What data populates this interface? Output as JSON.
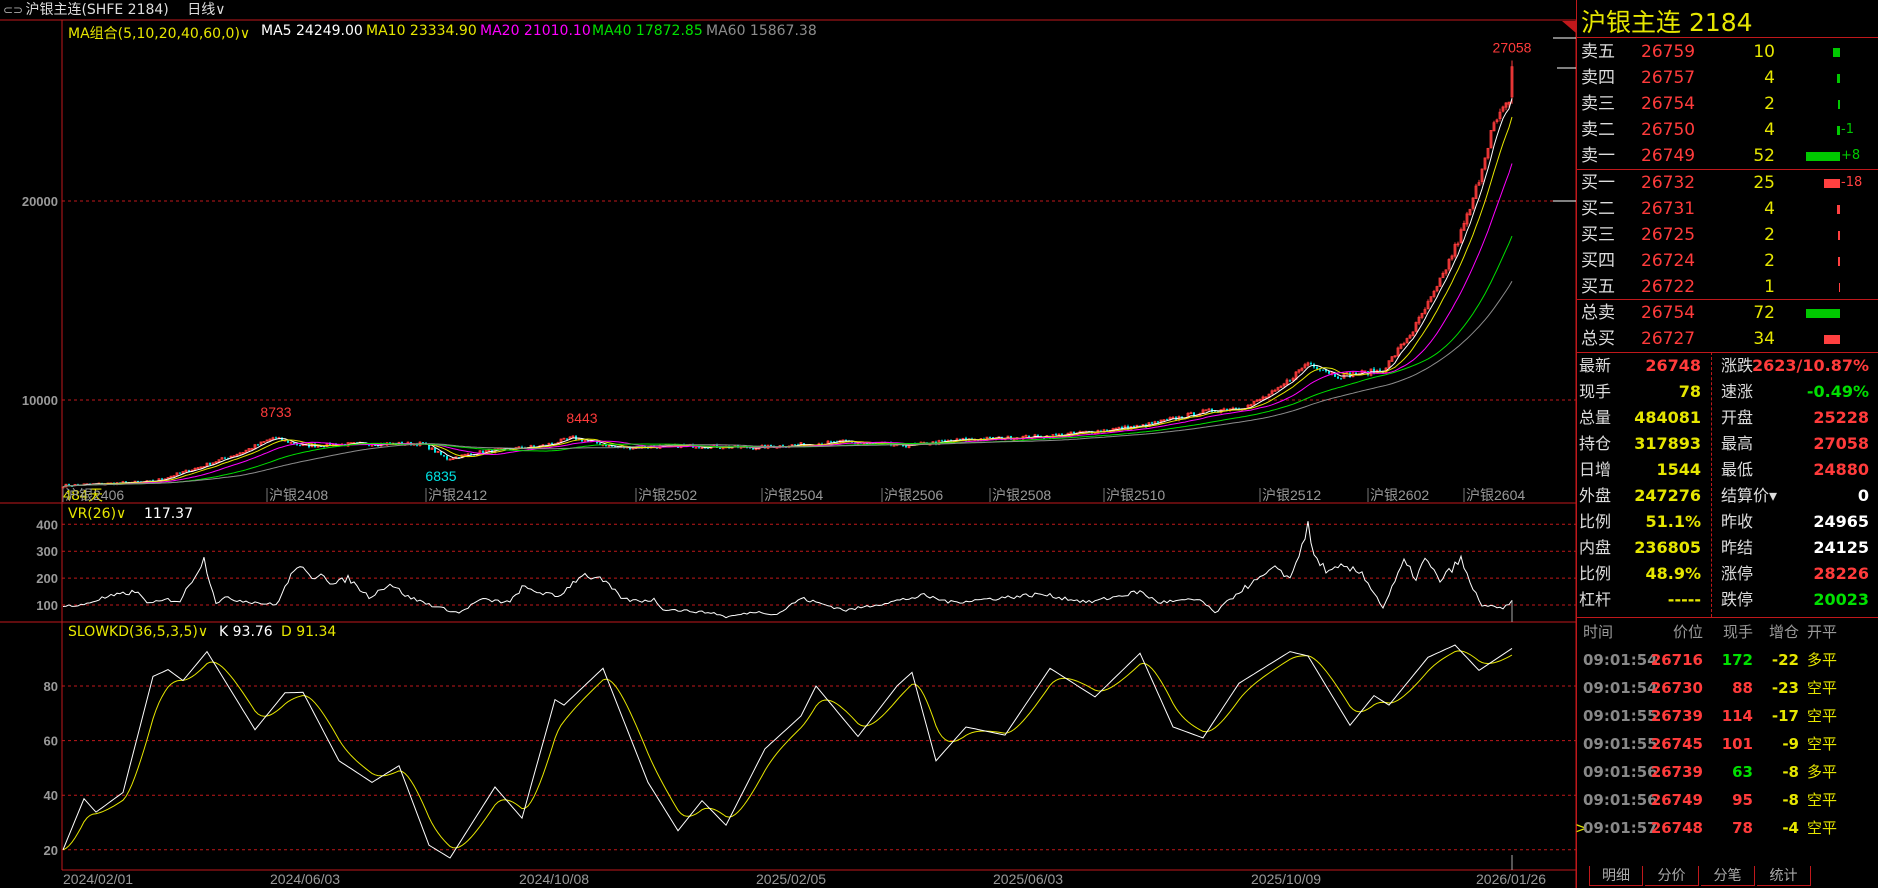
{
  "topbar": {
    "title": "沪银主连(SHFE 2184)",
    "period": "日线∨"
  },
  "indicators": {
    "ma_label": "MA组合(5,10,20,40,60,0)∨",
    "ma5": "MA5 24249.00",
    "ma10": "MA10 23334.90",
    "ma20": "MA20 21010.10",
    "ma40": "MA40 17872.85",
    "ma60": "MA60 15867.38",
    "vr_label": "VR(26)∨",
    "vr_value": "117.37",
    "kd_label": "SLOWKD(36,5,3,5)∨",
    "k_value": "K 93.76",
    "d_value": "D 91.34"
  },
  "colors": {
    "up": "#ff3b3b",
    "down": "#00e5e5",
    "ma5": "#ffffff",
    "ma10": "#e6e600",
    "ma20": "#ff00ff",
    "ma40": "#00e000",
    "ma60": "#8c8c8c",
    "grid": "#c0181b"
  },
  "chart_data": {
    "type": "candlestick",
    "bars": 484,
    "bar_count_label": "484天",
    "price_axis": {
      "ticks": [
        "20000",
        "10000"
      ],
      "values": [
        20000,
        10000
      ]
    },
    "close_anchors": [
      [
        0,
        5700
      ],
      [
        30,
        5900
      ],
      [
        45,
        6600
      ],
      [
        60,
        7400
      ],
      [
        70,
        8100
      ],
      [
        80,
        7700
      ],
      [
        100,
        7800
      ],
      [
        120,
        7800
      ],
      [
        128,
        7050
      ],
      [
        140,
        7400
      ],
      [
        160,
        7700
      ],
      [
        170,
        8100
      ],
      [
        185,
        7600
      ],
      [
        210,
        7700
      ],
      [
        230,
        7600
      ],
      [
        260,
        7900
      ],
      [
        280,
        7700
      ],
      [
        300,
        8000
      ],
      [
        330,
        8200
      ],
      [
        360,
        8700
      ],
      [
        380,
        9400
      ],
      [
        395,
        9700
      ],
      [
        405,
        10500
      ],
      [
        415,
        11900
      ],
      [
        425,
        11200
      ],
      [
        440,
        11500
      ],
      [
        450,
        13500
      ],
      [
        458,
        15600
      ],
      [
        465,
        18000
      ],
      [
        470,
        20000
      ],
      [
        476,
        23500
      ],
      [
        480,
        24500
      ],
      [
        482,
        24965
      ],
      [
        483,
        26748
      ]
    ],
    "last_bar": {
      "open": 25228,
      "high": 27058,
      "low": 24880,
      "close": 26748
    },
    "annotations": [
      {
        "text": "27058",
        "bar": 483,
        "price": 27058,
        "color": "up"
      },
      {
        "text": "8733",
        "bar": 71,
        "price": 8733,
        "color": "up"
      },
      {
        "text": "6835",
        "bar": 126,
        "price": 6835,
        "color": "down"
      },
      {
        "text": "8443",
        "bar": 173,
        "price": 8443,
        "color": "up"
      }
    ],
    "contract_labels": [
      {
        "bar": 0,
        "text": "沪银2406"
      },
      {
        "bar": 68,
        "text": "沪银2408"
      },
      {
        "bar": 121,
        "text": "沪银2412"
      },
      {
        "bar": 191,
        "text": "沪银2502"
      },
      {
        "bar": 233,
        "text": "沪银2504"
      },
      {
        "bar": 273,
        "text": "沪银2506"
      },
      {
        "bar": 309,
        "text": "沪银2508"
      },
      {
        "bar": 347,
        "text": "沪银2510"
      },
      {
        "bar": 399,
        "text": "沪银2512"
      },
      {
        "bar": 435,
        "text": "沪银2602"
      },
      {
        "bar": 467,
        "text": "沪银2604"
      }
    ],
    "date_labels": [
      {
        "bar": 0,
        "text": "2024/02/01"
      },
      {
        "bar": 69,
        "text": "2024/06/03"
      },
      {
        "bar": 152,
        "text": "2024/10/08"
      },
      {
        "bar": 231,
        "text": "2025/02/05"
      },
      {
        "bar": 310,
        "text": "2025/06/03"
      },
      {
        "bar": 396,
        "text": "2025/10/09"
      },
      {
        "bar": 471,
        "text": "2026/01/26"
      }
    ],
    "vr": {
      "ticks": [
        "400",
        "300",
        "200",
        "100"
      ],
      "values": [
        400,
        300,
        200,
        100
      ],
      "anchors": [
        [
          0,
          100
        ],
        [
          5,
          95
        ],
        [
          13,
          125
        ],
        [
          24,
          150
        ],
        [
          29,
          105
        ],
        [
          35,
          120
        ],
        [
          39,
          115
        ],
        [
          47,
          270
        ],
        [
          51,
          110
        ],
        [
          54,
          125
        ],
        [
          71,
          100
        ],
        [
          78,
          250
        ],
        [
          83,
          195
        ],
        [
          86,
          225
        ],
        [
          90,
          175
        ],
        [
          95,
          200
        ],
        [
          102,
          130
        ],
        [
          109,
          180
        ],
        [
          115,
          130
        ],
        [
          124,
          95
        ],
        [
          132,
          70
        ],
        [
          139,
          120
        ],
        [
          149,
          110
        ],
        [
          153,
          165
        ],
        [
          158,
          150
        ],
        [
          165,
          130
        ],
        [
          173,
          215
        ],
        [
          180,
          190
        ],
        [
          187,
          120
        ],
        [
          192,
          115
        ],
        [
          197,
          120
        ],
        [
          200,
          85
        ],
        [
          217,
          70
        ],
        [
          221,
          55
        ],
        [
          231,
          75
        ],
        [
          238,
          65
        ],
        [
          246,
          125
        ],
        [
          256,
          95
        ],
        [
          261,
          80
        ],
        [
          287,
          135
        ],
        [
          296,
          110
        ],
        [
          326,
          140
        ],
        [
          342,
          110
        ],
        [
          359,
          150
        ],
        [
          365,
          110
        ],
        [
          379,
          120
        ],
        [
          384,
          70
        ],
        [
          392,
          150
        ],
        [
          405,
          240
        ],
        [
          409,
          195
        ],
        [
          415,
          390
        ],
        [
          417,
          280
        ],
        [
          422,
          220
        ],
        [
          426,
          240
        ],
        [
          433,
          220
        ],
        [
          440,
          90
        ],
        [
          447,
          260
        ],
        [
          451,
          200
        ],
        [
          454,
          270
        ],
        [
          459,
          190
        ],
        [
          466,
          270
        ],
        [
          469,
          180
        ],
        [
          473,
          100
        ],
        [
          480,
          85
        ],
        [
          483,
          117.37
        ]
      ]
    },
    "kd": {
      "ticks": [
        "80",
        "60",
        "40",
        "20"
      ],
      "values": [
        80,
        60,
        40,
        20
      ],
      "k_anchors": [
        [
          0,
          20
        ],
        [
          7,
          38.7
        ],
        [
          11,
          33.8
        ],
        [
          20,
          41
        ],
        [
          30,
          83.5
        ],
        [
          35,
          86
        ],
        [
          40,
          82
        ],
        [
          48,
          92.6
        ],
        [
          64,
          64
        ],
        [
          74,
          77.5
        ],
        [
          80,
          77.7
        ],
        [
          92,
          52.6
        ],
        [
          103,
          44.7
        ],
        [
          112,
          50.8
        ],
        [
          122,
          21.7
        ],
        [
          129,
          17
        ],
        [
          144,
          43
        ],
        [
          153,
          31.6
        ],
        [
          164,
          75
        ],
        [
          167,
          73
        ],
        [
          180,
          86.5
        ],
        [
          195,
          44.7
        ],
        [
          205,
          27
        ],
        [
          213,
          38
        ],
        [
          221,
          29
        ],
        [
          234,
          57
        ],
        [
          246,
          69
        ],
        [
          251,
          80
        ],
        [
          265,
          61.5
        ],
        [
          278,
          80
        ],
        [
          283,
          85
        ],
        [
          291,
          52.6
        ],
        [
          301,
          65
        ],
        [
          314,
          62
        ],
        [
          329,
          86.5
        ],
        [
          344,
          76
        ],
        [
          359,
          92
        ],
        [
          370,
          65
        ],
        [
          380,
          61
        ],
        [
          392,
          81
        ],
        [
          409,
          92.6
        ],
        [
          415,
          91
        ],
        [
          429,
          65.6
        ],
        [
          437,
          76.5
        ],
        [
          442,
          73
        ],
        [
          455,
          90.5
        ],
        [
          464,
          95
        ],
        [
          472,
          85.7
        ],
        [
          483,
          93.76
        ]
      ],
      "d_last": 91.34
    }
  },
  "panel": {
    "title": "沪银主连  2184",
    "asks": [
      {
        "label": "卖五",
        "price": "26759",
        "vol": "10",
        "bar": 10,
        "chg": ""
      },
      {
        "label": "卖四",
        "price": "26757",
        "vol": "4",
        "bar": 4,
        "chg": ""
      },
      {
        "label": "卖三",
        "price": "26754",
        "vol": "2",
        "bar": 2,
        "chg": ""
      },
      {
        "label": "卖二",
        "price": "26750",
        "vol": "4",
        "bar": 4,
        "chg": "-1"
      },
      {
        "label": "卖一",
        "price": "26749",
        "vol": "52",
        "bar": 52,
        "chg": "+8"
      }
    ],
    "bids": [
      {
        "label": "买一",
        "price": "26732",
        "vol": "25",
        "bar": 25,
        "chg": "-18"
      },
      {
        "label": "买二",
        "price": "26731",
        "vol": "4",
        "bar": 4,
        "chg": ""
      },
      {
        "label": "买三",
        "price": "26725",
        "vol": "2",
        "bar": 2,
        "chg": ""
      },
      {
        "label": "买四",
        "price": "26724",
        "vol": "2",
        "bar": 2,
        "chg": ""
      },
      {
        "label": "买五",
        "price": "26722",
        "vol": "1",
        "bar": 1,
        "chg": ""
      }
    ],
    "totals": [
      {
        "label": "总卖",
        "price": "26754",
        "vol": "72",
        "bar": 52,
        "side": "ask"
      },
      {
        "label": "总买",
        "price": "26727",
        "vol": "34",
        "bar": 25,
        "side": "bid"
      }
    ],
    "stats": [
      {
        "l": "最新",
        "v": "26748",
        "vc": "#ff3b3b",
        "l2": "涨跌",
        "v2": "2623/10.87%",
        "v2c": "#ff3b3b"
      },
      {
        "l": "现手",
        "v": "78",
        "vc": "#e6e600",
        "l2": "速涨",
        "v2": "-0.49%",
        "v2c": "#00e000"
      },
      {
        "l": "总量",
        "v": "484081",
        "vc": "#e6e600",
        "l2": "开盘",
        "v2": "25228",
        "v2c": "#ff3b3b"
      },
      {
        "l": "持仓",
        "v": "317893",
        "vc": "#e6e600",
        "l2": "最高",
        "v2": "27058",
        "v2c": "#ff3b3b"
      },
      {
        "l": "日增",
        "v": "1544",
        "vc": "#e6e600",
        "l2": "最低",
        "v2": "24880",
        "v2c": "#ff3b3b"
      },
      {
        "l": "外盘",
        "v": "247276",
        "vc": "#e6e600",
        "l2": "结算价▾",
        "v2": "0",
        "v2c": "#ffffff"
      },
      {
        "l": "比例",
        "v": "51.1%",
        "vc": "#e6e600",
        "l2": "昨收",
        "v2": "24965",
        "v2c": "#ffffff"
      },
      {
        "l": "内盘",
        "v": "236805",
        "vc": "#e6e600",
        "l2": "昨结",
        "v2": "24125",
        "v2c": "#ffffff"
      },
      {
        "l": "比例",
        "v": "48.9%",
        "vc": "#e6e600",
        "l2": "涨停",
        "v2": "28226",
        "v2c": "#ff3b3b"
      },
      {
        "l": "杠杆",
        "v": "-----",
        "vc": "#e6e600",
        "l2": "跌停",
        "v2": "20023",
        "v2c": "#00e000"
      }
    ],
    "trade_headers": [
      "时间",
      "价位",
      "现手",
      "增仓",
      "开平"
    ],
    "trades": [
      {
        "time": "09:01:54",
        "price": "26716",
        "vol": "172",
        "volc": "#00e000",
        "oi": "-22",
        "type": "多平"
      },
      {
        "time": "09:01:54",
        "price": "26730",
        "vol": "88",
        "volc": "#ff3b3b",
        "oi": "-23",
        "type": "空平"
      },
      {
        "time": "09:01:55",
        "price": "26739",
        "vol": "114",
        "volc": "#ff3b3b",
        "oi": "-17",
        "type": "空平"
      },
      {
        "time": "09:01:55",
        "price": "26745",
        "vol": "101",
        "volc": "#ff3b3b",
        "oi": "-9",
        "type": "空平"
      },
      {
        "time": "09:01:56",
        "price": "26739",
        "vol": "63",
        "volc": "#00e000",
        "oi": "-8",
        "type": "多平"
      },
      {
        "time": "09:01:56",
        "price": "26749",
        "vol": "95",
        "volc": "#ff3b3b",
        "oi": "-8",
        "type": "空平"
      },
      {
        "time": "09:01:57",
        "price": "26748",
        "vol": "78",
        "volc": "#ff3b3b",
        "oi": "-4",
        "type": "空平"
      }
    ],
    "current_marker": ">",
    "tabs": [
      "明细",
      "分价",
      "分笔",
      "统计"
    ]
  }
}
